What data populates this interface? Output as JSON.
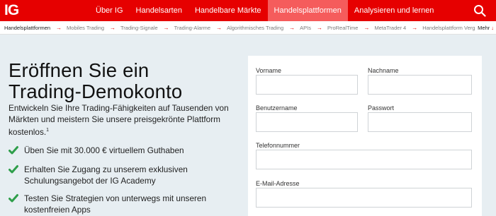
{
  "header": {
    "logo": "IG",
    "nav": [
      "Über IG",
      "Handelsarten",
      "Handelbare Märkte",
      "Handelsplattformen",
      "Analysieren und lernen"
    ],
    "active_nav": "Handelsplattformen",
    "search_icon": "search-icon"
  },
  "subnav": {
    "items": [
      "Handelsplattformen",
      "Mobiles Trading",
      "Trading-Signale",
      "Trading-Alarme",
      "Algorithmisches Trading",
      "APIs",
      "ProRealTime",
      "MetaTrader 4",
      "Handelsplattform Vergleich"
    ],
    "more": "Mehr",
    "arrow_icon": "arrow-right-icon"
  },
  "hero": {
    "title_line1": "Eröffnen Sie ein",
    "title_line2": "Trading-Demokonto",
    "intro": "Entwickeln Sie Ihre Trading-Fähigkeiten auf Tausenden von Märkten und meistern Sie unsere preisgekrönte Plattform kostenlos.",
    "footnote": "1",
    "benefits": [
      "Üben Sie mit 30.000 € virtuellem Guthaben",
      "Erhalten Sie Zugang zu unserem exklusiven Schulungsangebot der IG Academy",
      "Testen Sie Strategien von unterwegs mit unseren kostenfreien Apps"
    ]
  },
  "form": {
    "fields": {
      "firstname": {
        "label": "Vorname",
        "value": ""
      },
      "lastname": {
        "label": "Nachname",
        "value": ""
      },
      "username": {
        "label": "Benutzername",
        "value": ""
      },
      "password": {
        "label": "Passwort",
        "value": ""
      },
      "phone": {
        "label": "Telefonnummer",
        "value": ""
      },
      "email": {
        "label": "E-Mail-Adresse",
        "value": ""
      }
    }
  },
  "colors": {
    "brand_red": "#e60000",
    "active_tab": "#f55c5c",
    "check_green": "#2e9e4a",
    "page_bg": "#e7eef2"
  }
}
